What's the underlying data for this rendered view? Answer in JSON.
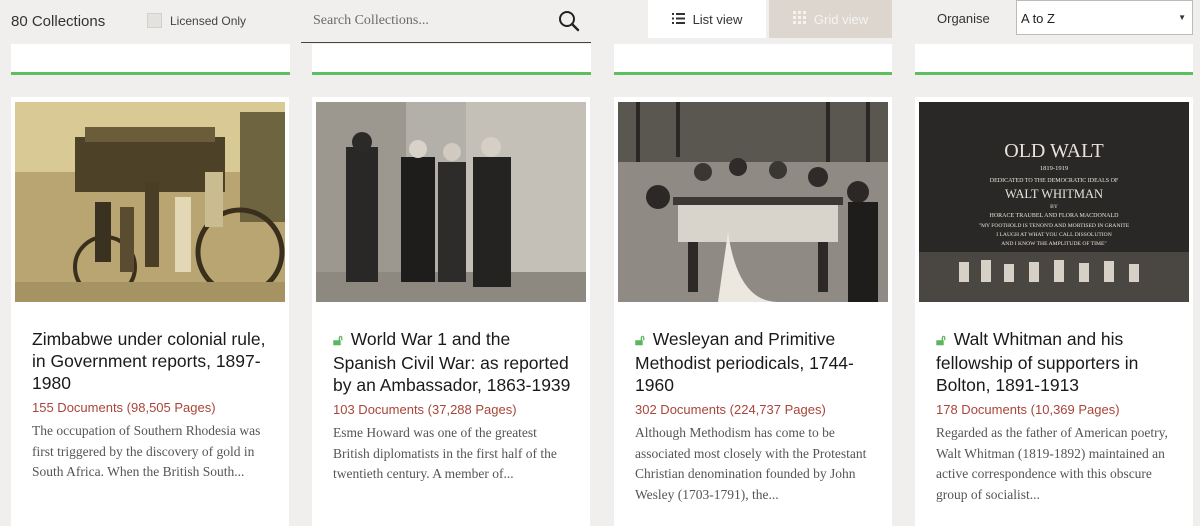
{
  "toolbar": {
    "count": "80 Collections",
    "licensed_label": "Licensed Only",
    "search_placeholder": "Search Collections...",
    "list_view_label": "List view",
    "grid_view_label": "Grid view",
    "organise_label": "Organise",
    "sort_value": "A to Z"
  },
  "colors": {
    "accent_green": "#5dbf5d",
    "doc_link": "#a9453a",
    "lock_icon": "#5db55d"
  },
  "cards": [
    {
      "title": "Zimbabwe under colonial rule, in Government reports, 1897-1980",
      "licensed_icon": false,
      "docs": "155 Documents (98,505 Pages)",
      "desc": "The occupation of Southern Rhodesia was first triggered by the discovery of gold in South Africa. When the British South..."
    },
    {
      "title": "World War 1 and the Spanish Civil War: as reported by an Ambassador, 1863-1939",
      "licensed_icon": true,
      "docs": "103 Documents (37,288 Pages)",
      "desc": "Esme Howard was one of the greatest British diplomatists in the first half of the twentieth century. A member of..."
    },
    {
      "title": "Wesleyan and Primitive Methodist periodicals, 1744-1960",
      "licensed_icon": true,
      "docs": "302 Documents (224,737 Pages)",
      "desc": "Although Methodism has come to be associated most closely with the Protestant Christian denomination founded by John Wesley (1703-1791), the..."
    },
    {
      "title": "Walt Whitman and his fellowship of supporters in Bolton, 1891-1913",
      "licensed_icon": true,
      "docs": "178 Documents (10,369 Pages)",
      "desc": "Regarded as the father of American poetry, Walt Whitman (1819-1892) maintained an active correspondence with this obscure group of socialist..."
    }
  ],
  "plaque": {
    "line1": "OLD WALT",
    "line2": "1819-1919",
    "line3": "DEDICATED TO THE DEMOCRATIC IDEALS OF",
    "line4": "WALT WHITMAN",
    "line5": "BY",
    "line6": "HORACE TRAUBEL AND FLORA MACDONALD",
    "line7": "\"MY FOOTHOLD IS TENON'D AND MORTISED IN GRANITE",
    "line8": "I LAUGH AT WHAT YOU CALL DISSOLUTION",
    "line9": "AND I KNOW THE AMPLITUDE OF TIME\""
  }
}
